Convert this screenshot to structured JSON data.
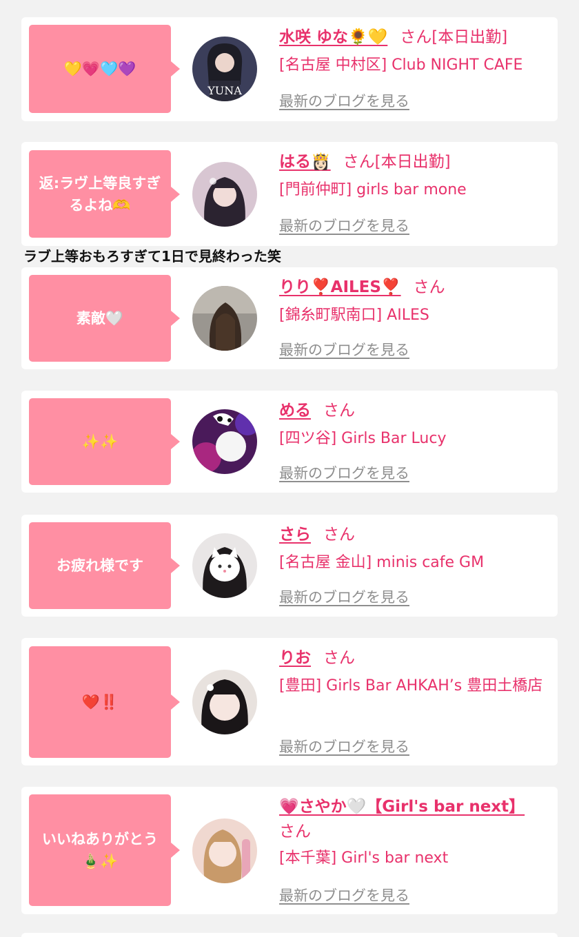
{
  "overlay_note": "ラブ上等おもろすぎて1日で見終わった笑",
  "san_suffix": "さん",
  "blog_link_label": "最新のブログを見る",
  "entries": [
    {
      "message": "💛💗🩵💜",
      "name": "水咲 ゆな🌻💛",
      "status": "[本日出勤]",
      "shop": "[名古屋 中村区] Club NIGHT CAFE",
      "avatar": "yuna-avatar"
    },
    {
      "message": "返:ラヴ上等良すぎるよね🫶",
      "name": "はる👸🏻",
      "status": "[本日出勤]",
      "shop": "[門前仲町] girls bar mone",
      "avatar": "haru-avatar"
    },
    {
      "message": "素敵🤍",
      "name": "りり❣️AILES❣️",
      "status": "",
      "shop": "[錦糸町駅南口] AILES",
      "avatar": "riri-avatar"
    },
    {
      "message": "✨✨",
      "name": "める",
      "status": "",
      "shop": "[四ツ谷] Girls Bar Lucy",
      "avatar": "meru-avatar"
    },
    {
      "message": "お疲れ様です",
      "name": "さら",
      "status": "",
      "shop": "[名古屋 金山] minis cafe GM",
      "avatar": "sara-avatar"
    },
    {
      "message": "❤️‼️",
      "name": "りお",
      "status": "",
      "shop": "[豊田] Girls Bar AHKAH’s 豊田土橋店",
      "avatar": "rio-avatar"
    },
    {
      "message": "いいねありがとう🎍✨",
      "name": "💗さやか🤍【Girl's bar next】",
      "status": "",
      "shop": "[本千葉] Girl's bar next",
      "avatar": "sayaka-avatar"
    }
  ],
  "colors": {
    "accent": "#e8316b",
    "bubble": "#ff8fa3",
    "muted": "#8e8e8e",
    "background": "#f2f2f2"
  }
}
